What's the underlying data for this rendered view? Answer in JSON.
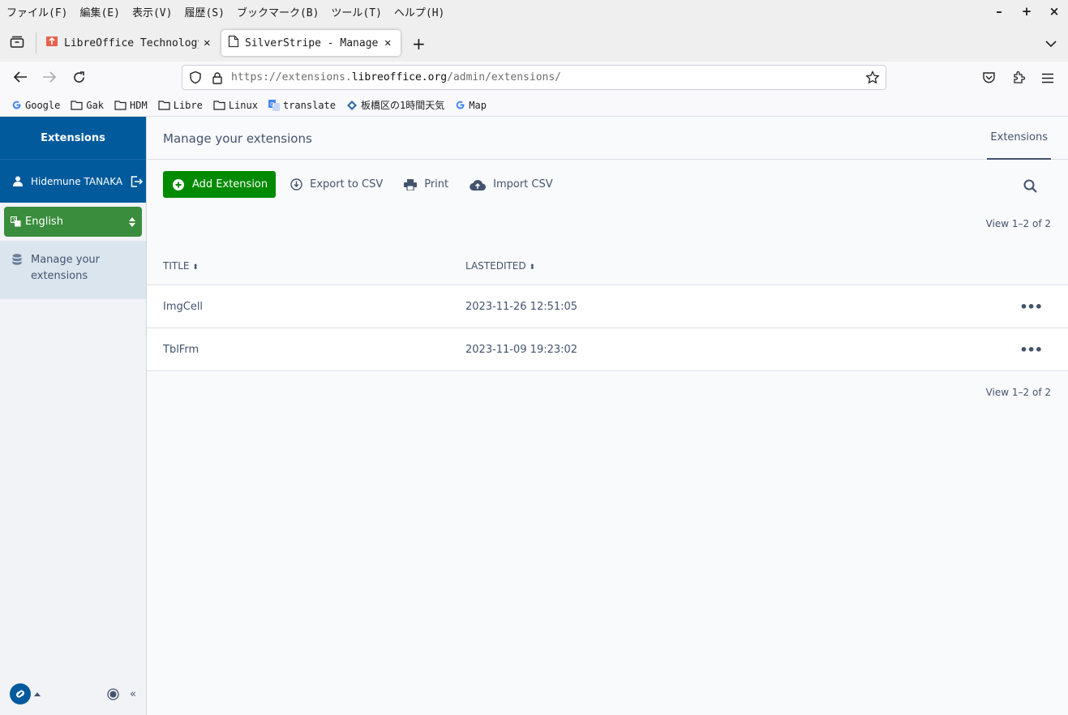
{
  "menu": [
    "ファイル(F)",
    "編集(E)",
    "表示(V)",
    "履歴(S)",
    "ブックマーク(B)",
    "ツール(T)",
    "ヘルプ(H)"
  ],
  "window_controls": {
    "minimize": "–",
    "maximize": "+",
    "close": "×"
  },
  "tabs": [
    {
      "title": "LibreOffice Technology Ad",
      "active": false
    },
    {
      "title": "SilverStripe - Manage you",
      "active": true
    }
  ],
  "url": {
    "prefix": "https://extensions.",
    "domain": "libreoffice.org",
    "path": "/admin/extensions/"
  },
  "bookmarks": [
    {
      "label": "Google",
      "icon": "google-icon"
    },
    {
      "label": "Gak",
      "icon": "folder-icon"
    },
    {
      "label": "HDM",
      "icon": "folder-icon"
    },
    {
      "label": "Libre",
      "icon": "folder-icon"
    },
    {
      "label": "Linux",
      "icon": "folder-icon"
    },
    {
      "label": "translate",
      "icon": "translate-icon"
    },
    {
      "label": "板橋区の1時間天気",
      "icon": "weather-icon"
    },
    {
      "label": "Map",
      "icon": "google-icon"
    }
  ],
  "sidebar": {
    "title": "Extensions",
    "user": "Hidemune TANAKA",
    "language": "English",
    "nav_item": "Manage your extensions"
  },
  "main": {
    "title": "Manage your extensions",
    "tab": "Extensions",
    "toolbar": {
      "add": "Add Extension",
      "export": "Export to CSV",
      "print": "Print",
      "import": "Import CSV"
    },
    "count_label": "View 1–2 of 2",
    "columns": [
      "TITLE",
      "LASTEDITED"
    ],
    "rows": [
      {
        "title": "ImgCell",
        "edited": "2023-11-26 12:51:05"
      },
      {
        "title": "TblFrm",
        "edited": "2023-11-09 19:23:02"
      }
    ],
    "row_actions": "•••"
  },
  "colors": {
    "brand": "#005a9c",
    "add_button": "#008a00",
    "language": "#3a8d3c"
  }
}
